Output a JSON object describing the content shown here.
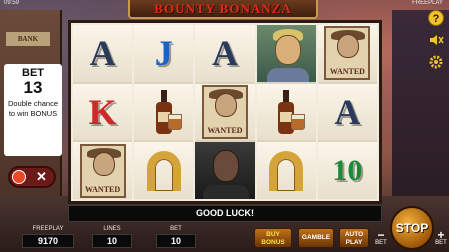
{
  "status": {
    "clock": "09:59",
    "mode_label": "FREEPLAY"
  },
  "game": {
    "title": "BOUNTY BONANZA"
  },
  "side_panel": {
    "bet_label": "BET",
    "bet_value": "13",
    "description": "Double chance to win BONUS"
  },
  "reels": [
    [
      {
        "symbol": "A",
        "color": "#2a3a5a"
      },
      {
        "symbol": "K",
        "color": "#d0282a"
      },
      {
        "symbol": "wanted-poster",
        "text": "WANTED"
      }
    ],
    [
      {
        "symbol": "J",
        "color": "#1a62c8"
      },
      {
        "symbol": "whiskey-bottle"
      },
      {
        "symbol": "horseshoe"
      }
    ],
    [
      {
        "symbol": "A",
        "color": "#2a3a5a"
      },
      {
        "symbol": "wanted-poster",
        "text": "WANTED"
      },
      {
        "symbol": "dark-outlaw"
      }
    ],
    [
      {
        "symbol": "blonde-outlaw"
      },
      {
        "symbol": "whiskey-bottle"
      },
      {
        "symbol": "horseshoe"
      }
    ],
    [
      {
        "symbol": "wanted-poster",
        "text": "WANTED"
      },
      {
        "symbol": "A",
        "color": "#2a3a5a"
      },
      {
        "symbol": "10",
        "color": "#1a8a3a"
      }
    ]
  ],
  "message": "GOOD LUCK!",
  "info": {
    "freeplay_label": "FREEPLAY",
    "freeplay_value": "9170",
    "lines_label": "LINES",
    "lines_value": "10",
    "bet_label": "BET",
    "bet_value": "10"
  },
  "buttons": {
    "buy_bonus": "BUY BONUS",
    "gamble": "GAMBLE",
    "autoplay": "AUTO PLAY",
    "stop": "STOP",
    "bet_minus_sign": "−",
    "bet_minus_label": "BET",
    "bet_plus_sign": "+",
    "bet_plus_label": "BET"
  },
  "icons": {
    "help": "?",
    "sound": "speaker-icon",
    "settings": "gear-icon"
  },
  "colors": {
    "accent": "#f2c22a",
    "title_red": "#e02a1a",
    "button_orange": "#c0711a"
  }
}
